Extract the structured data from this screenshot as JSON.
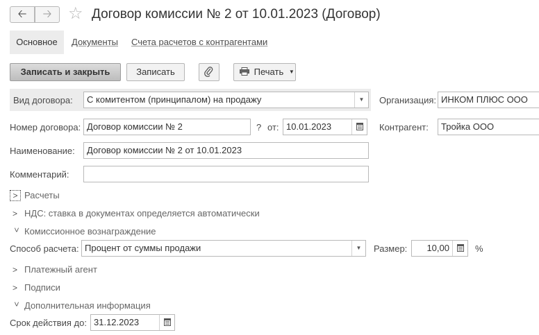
{
  "window": {
    "title": "Договор комиссии № 2 от 10.01.2023 (Договор)"
  },
  "tabs": [
    {
      "label": "Основное"
    },
    {
      "label": "Документы"
    },
    {
      "label": "Счета расчетов с контрагентами"
    }
  ],
  "toolbar": {
    "save_close_label": "Записать и закрыть",
    "save_label": "Записать",
    "print_label": "Печать"
  },
  "form": {
    "contract_type": {
      "label": "Вид договора:",
      "value": "С комитентом (принципалом) на продажу"
    },
    "organization": {
      "label": "Организация:",
      "value": "ИНКОМ ПЛЮС ООО"
    },
    "number": {
      "label": "Номер договора:",
      "value": "Договор комиссии № 2",
      "help": "?",
      "from_label": "от:",
      "date": "10.01.2023"
    },
    "counterparty": {
      "label": "Контрагент:",
      "value": "Тройка ООО"
    },
    "name": {
      "label": "Наименование:",
      "value": "Договор комиссии № 2 от 10.01.2023"
    },
    "comment": {
      "label": "Комментарий:",
      "value": ""
    }
  },
  "sections": {
    "settlements": "Расчеты",
    "vat": "НДС: ставка в документах определяется автоматически",
    "commission": "Комиссионное вознаграждение",
    "payment_agent": "Платежный агент",
    "signatures": "Подписи",
    "additional": "Дополнительная информация"
  },
  "commission": {
    "method_label": "Способ расчета:",
    "method_value": "Процент от суммы продажи",
    "size_label": "Размер:",
    "size_value": "10,00",
    "unit": "%"
  },
  "additional": {
    "valid_until_label": "Срок действия до:",
    "valid_until_value": "31.12.2023"
  }
}
